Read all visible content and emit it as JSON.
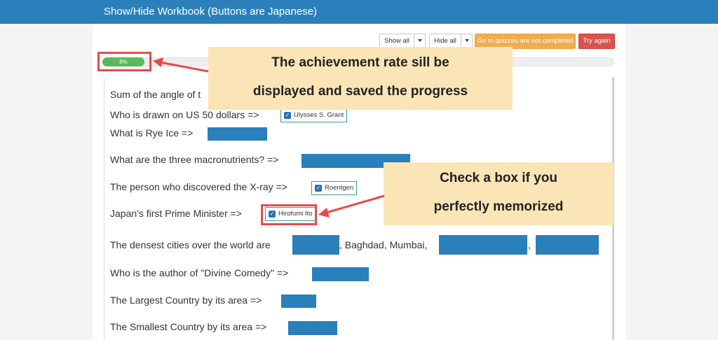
{
  "header": {
    "title": "Show/Hide Workbook (Buttons are Japanese)"
  },
  "toolbar": {
    "show_all": "Show all",
    "hide_all": "Hide all",
    "go_incomplete": "Go to quizzes are not completed",
    "try_again": "Try again"
  },
  "progress": {
    "label": "8%",
    "value": 8
  },
  "callouts": {
    "achievement": [
      "The achievement rate sill be",
      "displayed and saved the progress"
    ],
    "check": [
      "Check a box if you",
      "perfectly memorized"
    ]
  },
  "questions": [
    {
      "text": "Sum of the angle of t"
    },
    {
      "text": "Who is drawn on US 50 dollars =>",
      "checked_answer": "Ulysses S. Grant"
    },
    {
      "text": "What is Rye Ice =>"
    },
    {
      "text": "What are the three macronutrients? =>"
    },
    {
      "text": "The person who discovered the X-ray =>",
      "checked_answer": "Roentgen"
    },
    {
      "text": "Japan's first Prime Minister =>",
      "checked_answer": "Hirofumi Ito"
    },
    {
      "text": "The densest cities over the world are",
      "middle_text": ", Baghdad, Mumbai,",
      "comma": ","
    },
    {
      "text": "Who is the author of \"Divine Comedy\" =>"
    },
    {
      "text": "The Largest Country by its area =>"
    },
    {
      "text": "The Smallest Country by its area =>"
    }
  ],
  "colors": {
    "header": "#2a80ba",
    "answer_block": "#2a80ba",
    "progress": "#5cb85c",
    "highlight": "#e84a4a",
    "callout": "#fbe5b6"
  }
}
